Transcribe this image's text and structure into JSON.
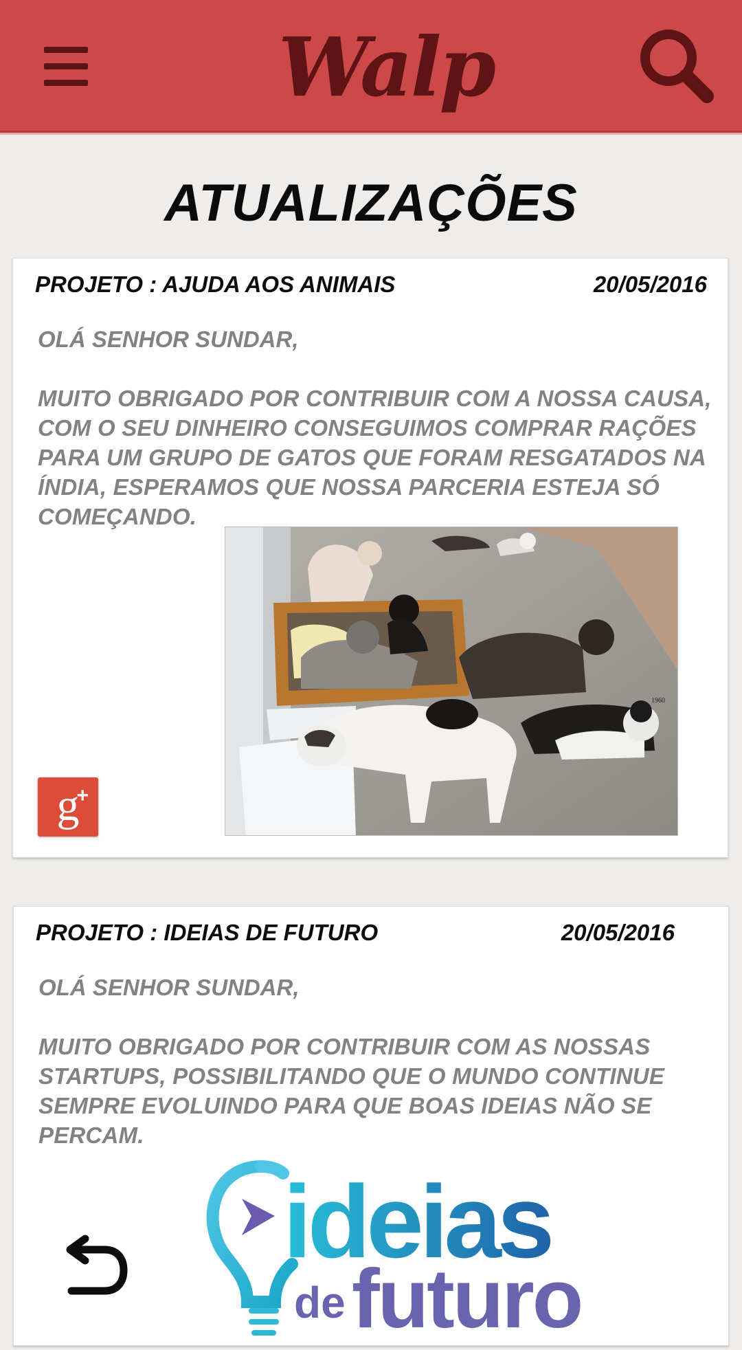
{
  "appbar": {
    "brand": "Walp",
    "menu_icon": "hamburger-menu-icon",
    "search_icon": "search-icon",
    "bg_color": "#cd4848",
    "accent_dark": "#5e1414"
  },
  "page": {
    "title": "ATUALIZAÇÕES"
  },
  "updates": [
    {
      "project": "PROJETO : AJUDA AOS ANIMAIS",
      "date": "20/05/2016",
      "greeting": "OLÁ SENHOR SUNDAR,",
      "message": "MUITO OBRIGADO POR CONTRIBUIR COM A NOSSA CAUSA, COM O SEU DINHEIRO CONSEGUIMOS COMPRAR RAÇÕES PARA UM GRUPO DE GATOS QUE FORAM RESGATADOS NA ÍNDIA, ESPERAMOS QUE NOSSA PARCERIA ESTEJA SÓ COMEÇANDO.",
      "photo_caption": "1960",
      "share_icon": "google-plus-icon"
    },
    {
      "project": "PROJETO : IDEIAS DE FUTURO",
      "date": "20/05/2016",
      "greeting": "OLÁ SENHOR SUNDAR,",
      "message": "MUITO OBRIGADO POR CONTRIBUIR COM AS NOSSAS STARTUPS, POSSIBILITANDO QUE O MUNDO CONTINUE SEMPRE EVOLUINDO PARA QUE BOAS IDEIAS NÃO SE PERCAM.",
      "logo_word1": "ideias",
      "logo_word2": "de",
      "logo_word3": "futuro"
    }
  ],
  "nav": {
    "back_icon": "back-arrow-icon"
  }
}
